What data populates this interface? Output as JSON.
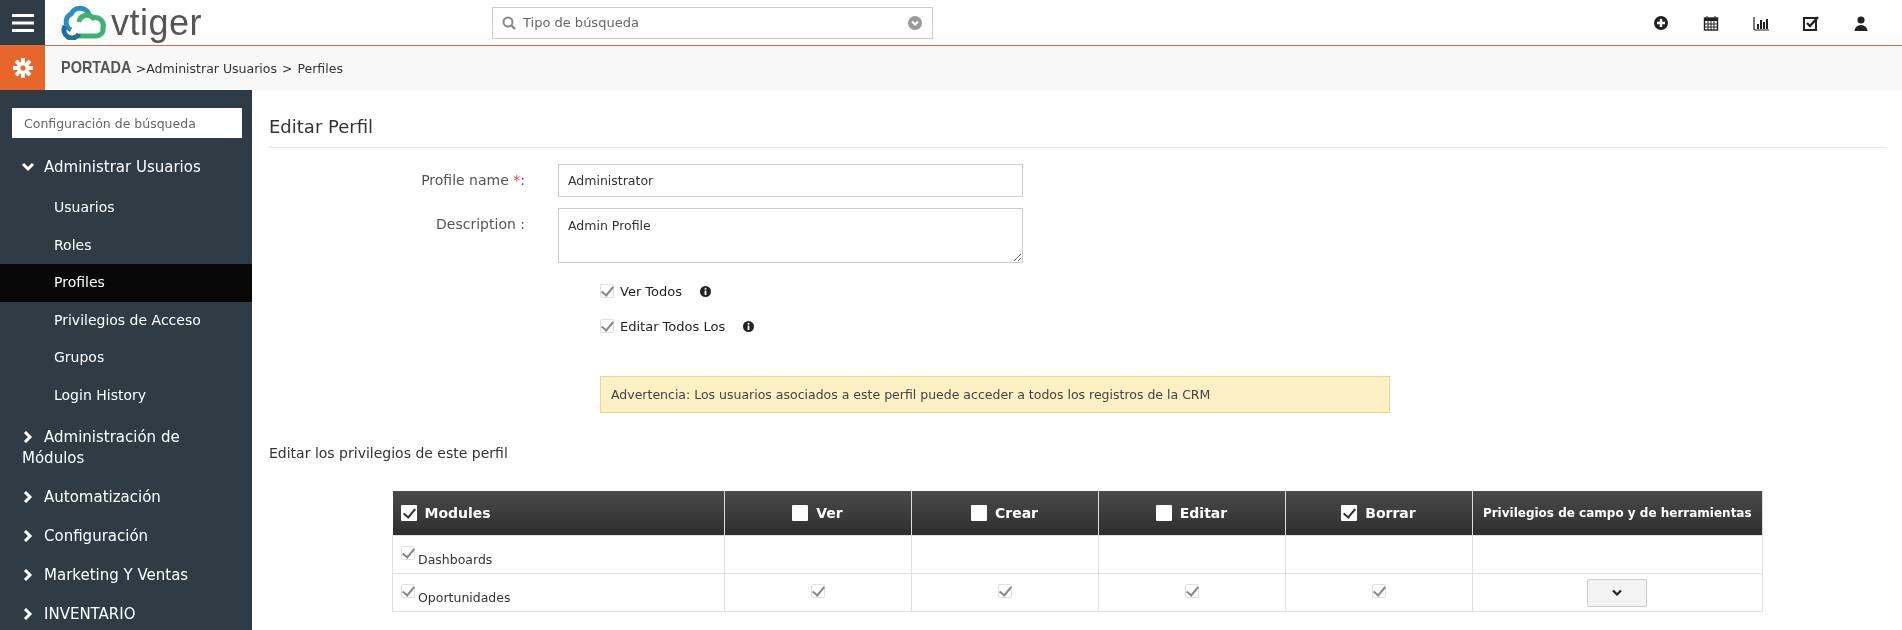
{
  "topbar": {
    "logo": "vtiger",
    "search": {
      "placeholder": "Tipo de búsqueda"
    }
  },
  "breadcrumb": [
    {
      "kind": "home",
      "text": "PORTADA"
    },
    {
      "kind": "link",
      "text": ">Administrar Usuarios"
    },
    {
      "kind": "sep",
      "text": ">"
    },
    {
      "kind": "current",
      "text": "Perfiles"
    }
  ],
  "sidebar": {
    "search": {
      "placeholder": "Configuración de búsqueda"
    },
    "groups": [
      {
        "label": "Administrar Usuarios",
        "expanded": true,
        "items": [
          {
            "label": "Usuarios",
            "selected": false
          },
          {
            "label": "Roles",
            "selected": false
          },
          {
            "label": "Profiles",
            "selected": true
          },
          {
            "label": "Privilegios de Acceso",
            "selected": false
          },
          {
            "label": "Grupos",
            "selected": false
          },
          {
            "label": "Login History",
            "selected": false
          }
        ]
      },
      {
        "label": "Administración de Módulos",
        "expanded": false
      },
      {
        "label": "Automatización",
        "expanded": false
      },
      {
        "label": "Configuración",
        "expanded": false
      },
      {
        "label": "Marketing Y Ventas",
        "expanded": false
      },
      {
        "label": "INVENTARIO",
        "expanded": false
      }
    ]
  },
  "form": {
    "title": "Editar Perfil",
    "fields": [
      {
        "kind": "input",
        "label": "Profile name",
        "required_mark": "*",
        "suffix": ":",
        "value": "Administrator"
      },
      {
        "kind": "textarea",
        "label": "Description :",
        "value": "Admin Profile"
      }
    ],
    "options": [
      {
        "label": "Ver Todos",
        "checked": true
      },
      {
        "label": "Editar Todos Los",
        "checked": true
      }
    ],
    "warning": "Advertencia: Los usuarios asociados a este perfil puede acceder a todos los registros de la CRM",
    "section": "Editar los privilegios de este perfil",
    "table": {
      "columns": [
        {
          "label": "Modules",
          "kind": "checkbox",
          "checked": true
        },
        {
          "label": "Ver",
          "kind": "checkbox",
          "checked": false
        },
        {
          "label": "Crear",
          "kind": "checkbox",
          "checked": false
        },
        {
          "label": "Editar",
          "kind": "checkbox",
          "checked": false
        },
        {
          "label": "Borrar",
          "kind": "checkbox",
          "checked": true
        },
        {
          "label": "Privilegios de campo y de herramientas",
          "kind": "text"
        }
      ],
      "rows": [
        {
          "module": "Dashboards",
          "checked": true,
          "cells": [
            {
              "kind": "empty"
            },
            {
              "kind": "empty"
            },
            {
              "kind": "empty"
            },
            {
              "kind": "empty"
            },
            {
              "kind": "empty"
            }
          ]
        },
        {
          "module": "Oportunidades",
          "checked": true,
          "cells": [
            {
              "kind": "checkbox",
              "checked": true
            },
            {
              "kind": "checkbox",
              "checked": true
            },
            {
              "kind": "checkbox",
              "checked": true
            },
            {
              "kind": "checkbox",
              "checked": true
            },
            {
              "kind": "dropdown"
            }
          ]
        }
      ]
    }
  }
}
